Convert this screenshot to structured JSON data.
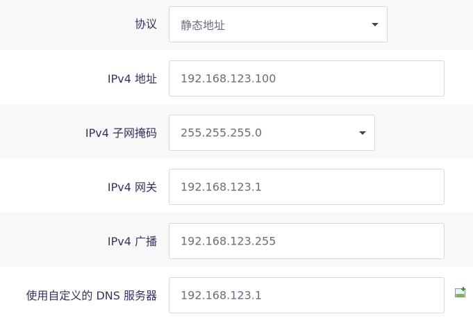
{
  "form": {
    "protocol": {
      "label": "协议",
      "value": "静态地址"
    },
    "ipv4_address": {
      "label": "IPv4 地址",
      "value": "192.168.123.100"
    },
    "ipv4_netmask": {
      "label": "IPv4 子网掩码",
      "value": "255.255.255.0"
    },
    "ipv4_gateway": {
      "label": "IPv4 网关",
      "value": "192.168.123.1"
    },
    "ipv4_broadcast": {
      "label": "IPv4 广播",
      "value": "192.168.123.255"
    },
    "custom_dns": {
      "label": "使用自定义的 DNS 服务器",
      "value": "192.168.123.1",
      "add_icon": "add-entry-icon"
    }
  },
  "colors": {
    "label_text": "#32325d",
    "value_text": "#6c6c7c",
    "row_shade": "#f8f8f8",
    "border": "#d8d8d8"
  }
}
